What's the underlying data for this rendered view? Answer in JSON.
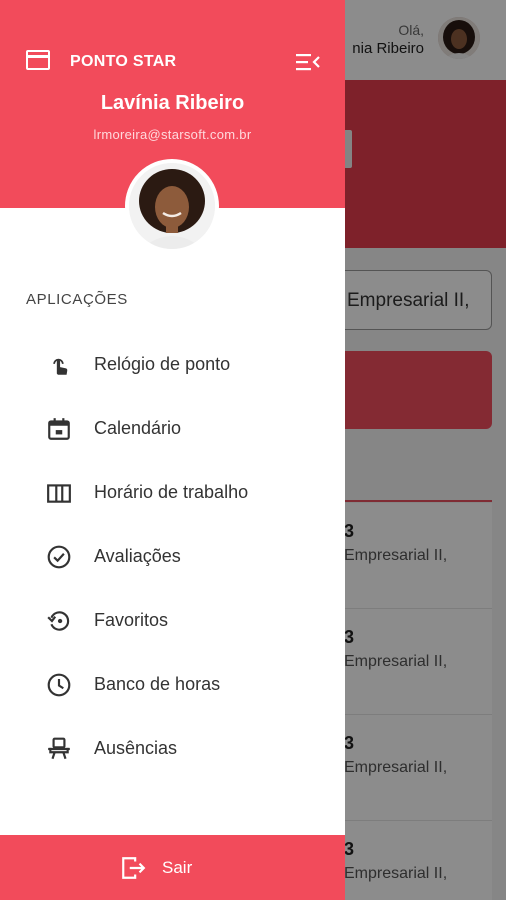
{
  "app": {
    "name": "PONTO STAR"
  },
  "user": {
    "name": "Lavínia Ribeiro",
    "email": "lrmoreira@starsoft.com.br"
  },
  "background": {
    "greeting": "Olá,",
    "greeting_name": "nia Ribeiro",
    "select_value": "Empresarial II,",
    "list_items": [
      {
        "number": "3",
        "text": "Empresarial II,"
      },
      {
        "number": "3",
        "text": "Empresarial II,"
      },
      {
        "number": "3",
        "text": "Empresarial II,"
      },
      {
        "number": "3",
        "text": "Empresarial II,"
      }
    ]
  },
  "drawer": {
    "section_label": "APLICAÇÕES",
    "items": [
      {
        "label": "Relógio de ponto",
        "icon": "touch-icon"
      },
      {
        "label": "Calendário",
        "icon": "calendar-icon"
      },
      {
        "label": "Horário de trabalho",
        "icon": "columns-icon"
      },
      {
        "label": "Avaliações",
        "icon": "check-circle-icon"
      },
      {
        "label": "Favoritos",
        "icon": "restore-icon"
      },
      {
        "label": "Banco de horas",
        "icon": "clock-icon"
      },
      {
        "label": "Ausências",
        "icon": "chair-icon"
      }
    ],
    "logout_label": "Sair"
  },
  "colors": {
    "accent": "#f24b5b",
    "banner": "#e63d4e",
    "text": "#333333"
  }
}
